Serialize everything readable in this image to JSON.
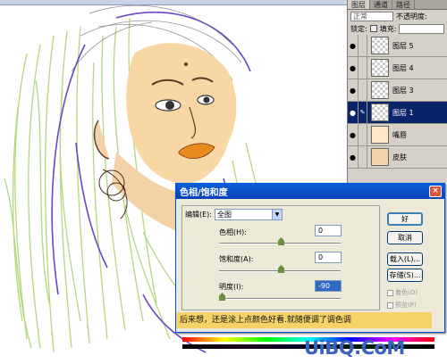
{
  "layers_panel": {
    "tabs": [
      "图层",
      "通道",
      "路径"
    ],
    "blend_mode": "正常",
    "opacity_label": "不透明度:",
    "lock_label": "锁定:",
    "fill_label": "填充:",
    "layers": [
      {
        "name": "图层 5",
        "thumb": "transparent",
        "selected": false
      },
      {
        "name": "图层 4",
        "thumb": "transparent",
        "selected": false
      },
      {
        "name": "图层 3",
        "thumb": "transparent",
        "selected": false
      },
      {
        "name": "图层 1",
        "thumb": "transparent",
        "selected": true
      },
      {
        "name": "嘴唇",
        "thumb": "lips",
        "selected": false
      },
      {
        "name": "皮肤",
        "thumb": "skin",
        "selected": false
      }
    ],
    "eye_glyph": "●",
    "brush_glyph": "✎"
  },
  "dialog": {
    "title": "色相/饱和度",
    "close": "×",
    "edit_label": "编辑(E):",
    "edit_value": "全图",
    "hue_label": "色相(H):",
    "hue_value": "0",
    "saturation_label": "饱和度(A):",
    "saturation_value": "0",
    "lightness_label": "明度(I):",
    "lightness_value": "-90",
    "ok_label": "好",
    "cancel_label": "取消",
    "load_label": "载入(L)...",
    "save_label": "存储(S)...",
    "colorize_label": "着色(O)",
    "preview_label": "预览(P)"
  },
  "note": "后来想，还是涂上点颜色好看.就随便调了调色调",
  "watermark": "UiBQ.CoM"
}
